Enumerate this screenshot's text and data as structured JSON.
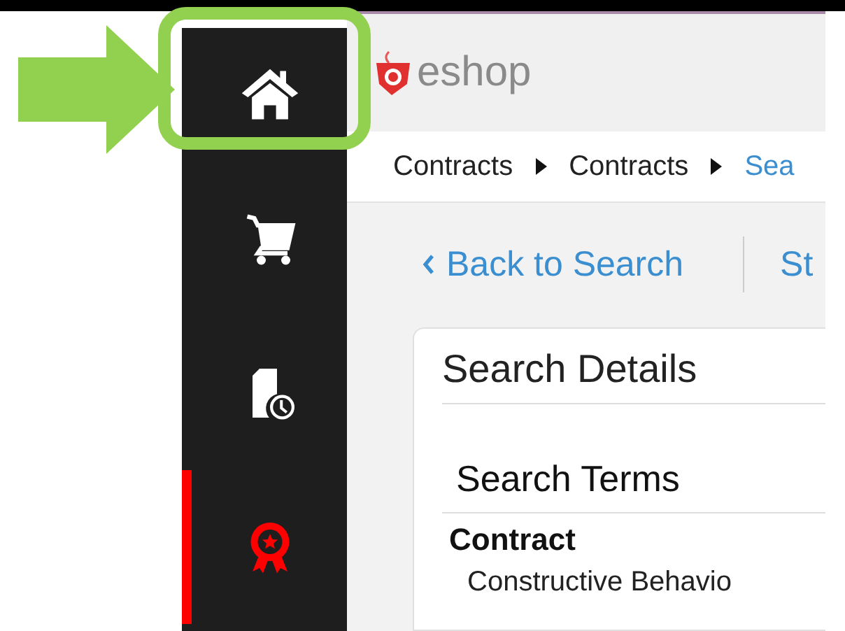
{
  "sidebar": {
    "items": [
      {
        "kind": "home",
        "selected": false,
        "highlighted": true
      },
      {
        "kind": "cart",
        "selected": false,
        "highlighted": false
      },
      {
        "kind": "history",
        "selected": false,
        "highlighted": false
      },
      {
        "kind": "award",
        "selected": true,
        "highlighted": false
      }
    ]
  },
  "header": {
    "logo": "eshop"
  },
  "breadcrumb": [
    {
      "label": "Contracts",
      "link": false
    },
    {
      "label": "Contracts",
      "link": false
    },
    {
      "label": "Sea",
      "link": true
    }
  ],
  "toolbar": {
    "back": "Back to Search",
    "next": "St"
  },
  "card": {
    "title": "Search Details",
    "section": "Search Terms",
    "label": "Contract",
    "value": "Constructive Behavio"
  }
}
